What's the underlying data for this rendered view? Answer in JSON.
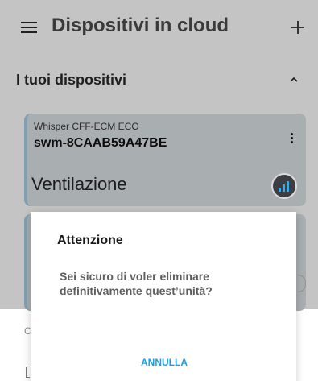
{
  "appbar": {
    "title": "Dispositivi in cloud",
    "menu_icon": "menu-icon",
    "add_icon": "plus-icon"
  },
  "section": {
    "title": "I tuoi dispositivi",
    "collapse_icon": "chevron-up-icon"
  },
  "device": {
    "model": "Whisper CFF-ECM ECO",
    "name": "swm-8CAAB59A47BE",
    "mode": "Ventilazione",
    "mode_icon": "signal-bars-icon",
    "options_icon": "more-vert-icon"
  },
  "peek": {
    "c_letter": "C"
  },
  "dialog": {
    "title": "Attenzione",
    "message": "Sei sicuro di voler eliminare definitivamente quest’unità?",
    "cancel_label": "ANNULLA"
  },
  "colors": {
    "accent": "#1e9ee1",
    "scrim": "#c4c4c4",
    "card": "#a9aeb1"
  }
}
